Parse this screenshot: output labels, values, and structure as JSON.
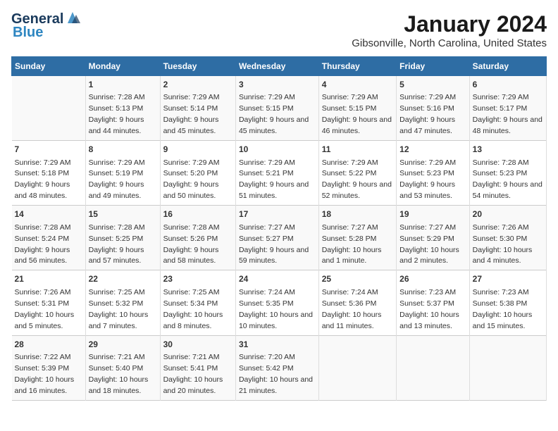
{
  "header": {
    "logo_line1": "General",
    "logo_line2": "Blue",
    "title": "January 2024",
    "subtitle": "Gibsonville, North Carolina, United States"
  },
  "columns": [
    "Sunday",
    "Monday",
    "Tuesday",
    "Wednesday",
    "Thursday",
    "Friday",
    "Saturday"
  ],
  "weeks": [
    [
      {
        "day": "",
        "sunrise": "",
        "sunset": "",
        "daylight": ""
      },
      {
        "day": "1",
        "sunrise": "Sunrise: 7:28 AM",
        "sunset": "Sunset: 5:13 PM",
        "daylight": "Daylight: 9 hours and 44 minutes."
      },
      {
        "day": "2",
        "sunrise": "Sunrise: 7:29 AM",
        "sunset": "Sunset: 5:14 PM",
        "daylight": "Daylight: 9 hours and 45 minutes."
      },
      {
        "day": "3",
        "sunrise": "Sunrise: 7:29 AM",
        "sunset": "Sunset: 5:15 PM",
        "daylight": "Daylight: 9 hours and 45 minutes."
      },
      {
        "day": "4",
        "sunrise": "Sunrise: 7:29 AM",
        "sunset": "Sunset: 5:15 PM",
        "daylight": "Daylight: 9 hours and 46 minutes."
      },
      {
        "day": "5",
        "sunrise": "Sunrise: 7:29 AM",
        "sunset": "Sunset: 5:16 PM",
        "daylight": "Daylight: 9 hours and 47 minutes."
      },
      {
        "day": "6",
        "sunrise": "Sunrise: 7:29 AM",
        "sunset": "Sunset: 5:17 PM",
        "daylight": "Daylight: 9 hours and 48 minutes."
      }
    ],
    [
      {
        "day": "7",
        "sunrise": "Sunrise: 7:29 AM",
        "sunset": "Sunset: 5:18 PM",
        "daylight": "Daylight: 9 hours and 48 minutes."
      },
      {
        "day": "8",
        "sunrise": "Sunrise: 7:29 AM",
        "sunset": "Sunset: 5:19 PM",
        "daylight": "Daylight: 9 hours and 49 minutes."
      },
      {
        "day": "9",
        "sunrise": "Sunrise: 7:29 AM",
        "sunset": "Sunset: 5:20 PM",
        "daylight": "Daylight: 9 hours and 50 minutes."
      },
      {
        "day": "10",
        "sunrise": "Sunrise: 7:29 AM",
        "sunset": "Sunset: 5:21 PM",
        "daylight": "Daylight: 9 hours and 51 minutes."
      },
      {
        "day": "11",
        "sunrise": "Sunrise: 7:29 AM",
        "sunset": "Sunset: 5:22 PM",
        "daylight": "Daylight: 9 hours and 52 minutes."
      },
      {
        "day": "12",
        "sunrise": "Sunrise: 7:29 AM",
        "sunset": "Sunset: 5:23 PM",
        "daylight": "Daylight: 9 hours and 53 minutes."
      },
      {
        "day": "13",
        "sunrise": "Sunrise: 7:28 AM",
        "sunset": "Sunset: 5:23 PM",
        "daylight": "Daylight: 9 hours and 54 minutes."
      }
    ],
    [
      {
        "day": "14",
        "sunrise": "Sunrise: 7:28 AM",
        "sunset": "Sunset: 5:24 PM",
        "daylight": "Daylight: 9 hours and 56 minutes."
      },
      {
        "day": "15",
        "sunrise": "Sunrise: 7:28 AM",
        "sunset": "Sunset: 5:25 PM",
        "daylight": "Daylight: 9 hours and 57 minutes."
      },
      {
        "day": "16",
        "sunrise": "Sunrise: 7:28 AM",
        "sunset": "Sunset: 5:26 PM",
        "daylight": "Daylight: 9 hours and 58 minutes."
      },
      {
        "day": "17",
        "sunrise": "Sunrise: 7:27 AM",
        "sunset": "Sunset: 5:27 PM",
        "daylight": "Daylight: 9 hours and 59 minutes."
      },
      {
        "day": "18",
        "sunrise": "Sunrise: 7:27 AM",
        "sunset": "Sunset: 5:28 PM",
        "daylight": "Daylight: 10 hours and 1 minute."
      },
      {
        "day": "19",
        "sunrise": "Sunrise: 7:27 AM",
        "sunset": "Sunset: 5:29 PM",
        "daylight": "Daylight: 10 hours and 2 minutes."
      },
      {
        "day": "20",
        "sunrise": "Sunrise: 7:26 AM",
        "sunset": "Sunset: 5:30 PM",
        "daylight": "Daylight: 10 hours and 4 minutes."
      }
    ],
    [
      {
        "day": "21",
        "sunrise": "Sunrise: 7:26 AM",
        "sunset": "Sunset: 5:31 PM",
        "daylight": "Daylight: 10 hours and 5 minutes."
      },
      {
        "day": "22",
        "sunrise": "Sunrise: 7:25 AM",
        "sunset": "Sunset: 5:32 PM",
        "daylight": "Daylight: 10 hours and 7 minutes."
      },
      {
        "day": "23",
        "sunrise": "Sunrise: 7:25 AM",
        "sunset": "Sunset: 5:34 PM",
        "daylight": "Daylight: 10 hours and 8 minutes."
      },
      {
        "day": "24",
        "sunrise": "Sunrise: 7:24 AM",
        "sunset": "Sunset: 5:35 PM",
        "daylight": "Daylight: 10 hours and 10 minutes."
      },
      {
        "day": "25",
        "sunrise": "Sunrise: 7:24 AM",
        "sunset": "Sunset: 5:36 PM",
        "daylight": "Daylight: 10 hours and 11 minutes."
      },
      {
        "day": "26",
        "sunrise": "Sunrise: 7:23 AM",
        "sunset": "Sunset: 5:37 PM",
        "daylight": "Daylight: 10 hours and 13 minutes."
      },
      {
        "day": "27",
        "sunrise": "Sunrise: 7:23 AM",
        "sunset": "Sunset: 5:38 PM",
        "daylight": "Daylight: 10 hours and 15 minutes."
      }
    ],
    [
      {
        "day": "28",
        "sunrise": "Sunrise: 7:22 AM",
        "sunset": "Sunset: 5:39 PM",
        "daylight": "Daylight: 10 hours and 16 minutes."
      },
      {
        "day": "29",
        "sunrise": "Sunrise: 7:21 AM",
        "sunset": "Sunset: 5:40 PM",
        "daylight": "Daylight: 10 hours and 18 minutes."
      },
      {
        "day": "30",
        "sunrise": "Sunrise: 7:21 AM",
        "sunset": "Sunset: 5:41 PM",
        "daylight": "Daylight: 10 hours and 20 minutes."
      },
      {
        "day": "31",
        "sunrise": "Sunrise: 7:20 AM",
        "sunset": "Sunset: 5:42 PM",
        "daylight": "Daylight: 10 hours and 21 minutes."
      },
      {
        "day": "",
        "sunrise": "",
        "sunset": "",
        "daylight": ""
      },
      {
        "day": "",
        "sunrise": "",
        "sunset": "",
        "daylight": ""
      },
      {
        "day": "",
        "sunrise": "",
        "sunset": "",
        "daylight": ""
      }
    ]
  ]
}
